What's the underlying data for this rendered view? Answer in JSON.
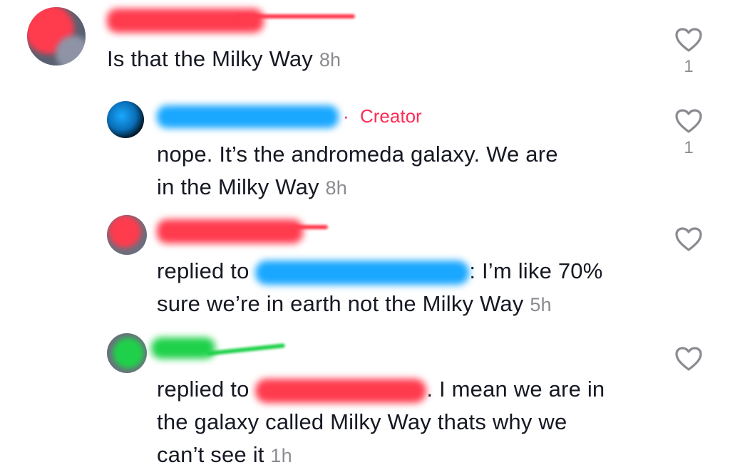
{
  "comments": [
    {
      "text": "Is that the Milky Way",
      "time": "8h",
      "likes": "1"
    },
    {
      "creator_label": "Creator",
      "creator_sep": "·",
      "text_line1": "nope. It’s the andromeda galaxy. We are",
      "text_line2": "in the Milky Way",
      "time": "8h",
      "likes": "1"
    },
    {
      "replied_to": "replied to",
      "text_after": ": I’m like 70%",
      "text_line2": "sure we’re in earth not the Milky Way",
      "time": "5h"
    },
    {
      "replied_to": "replied to",
      "text_after": ". I mean we are in",
      "text_line2": "the galaxy called Milky Way thats why we",
      "text_line3": "can’t see it",
      "time": "1h"
    }
  ],
  "colors": {
    "accent": "#fe2c55",
    "redact_red": "#ff3b4e",
    "redact_blue": "#19a7ff",
    "redact_green": "#1fd14a",
    "muted": "#8a8b91"
  }
}
